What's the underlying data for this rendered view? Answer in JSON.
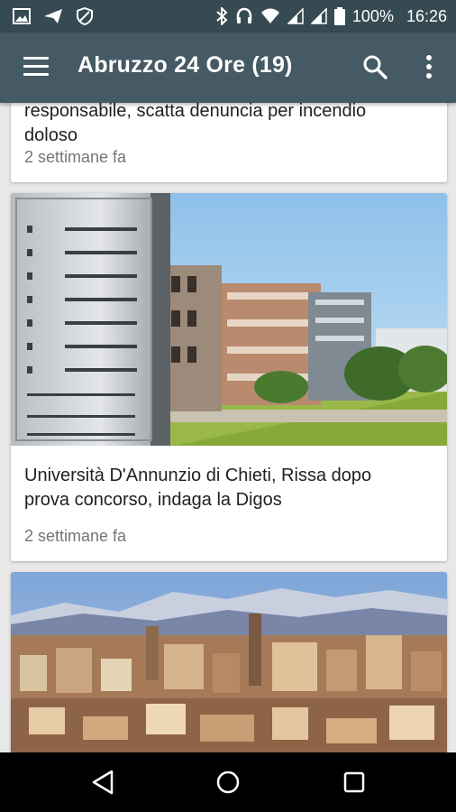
{
  "status_bar": {
    "battery": "100%",
    "time": "16:26",
    "icons": [
      "image-icon",
      "send-icon",
      "blocked-icon",
      "bluetooth-icon",
      "headset-icon",
      "wifi-icon",
      "signal-icon",
      "signal-icon",
      "battery-icon"
    ]
  },
  "app_bar": {
    "title": "Abruzzo 24 Ore (19)",
    "icons": [
      "menu-icon",
      "search-icon",
      "more-vert-icon"
    ]
  },
  "articles": [
    {
      "title_line1": "responsabile, scatta denuncia per incendio",
      "title_line2": "doloso",
      "time": "2 settimane fa"
    },
    {
      "title_line1": "Università D'Annunzio di Chieti, Rissa dopo",
      "title_line2": "prova concorso, indaga la Digos",
      "time": "2 settimane fa",
      "image": "university-campus-photo"
    },
    {
      "image": "city-panorama-photo"
    }
  ],
  "nav_bar": {
    "icons": [
      "back-icon",
      "home-icon",
      "recent-apps-icon"
    ]
  }
}
